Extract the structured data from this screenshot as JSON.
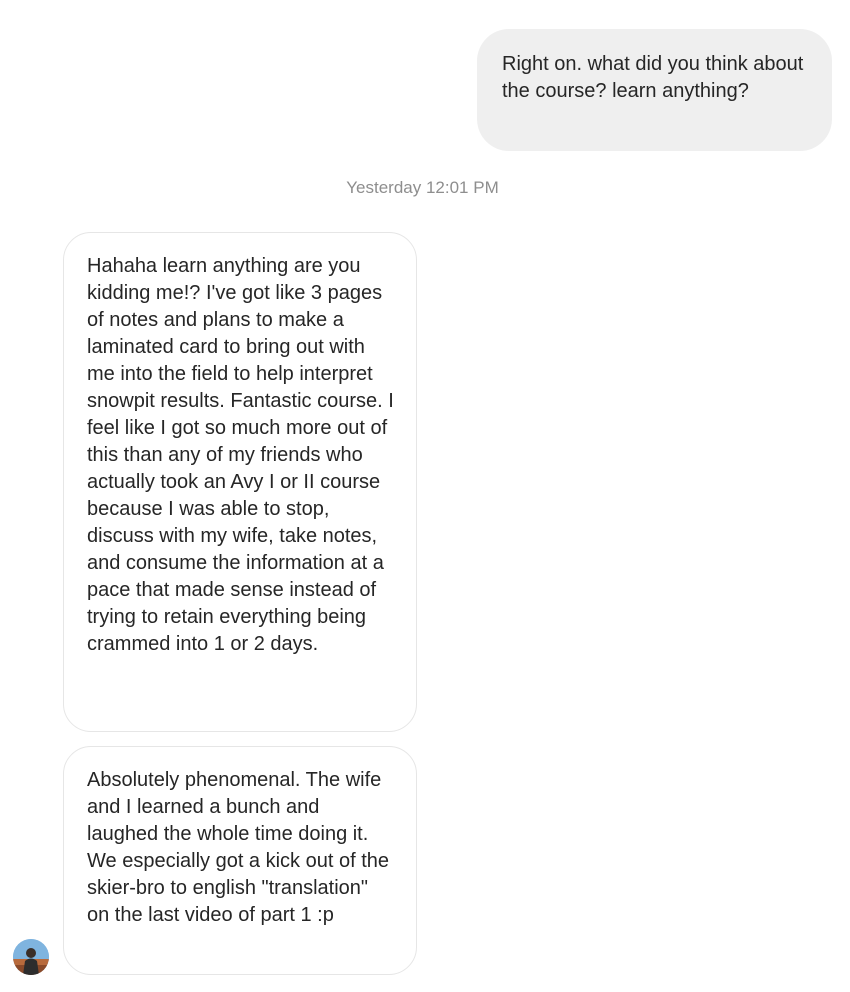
{
  "conversation": {
    "outgoing": {
      "text": "Right on. what did you think about the course? learn anything?"
    },
    "timestamp": "Yesterday 12:01 PM",
    "incoming": [
      {
        "text": "Hahaha learn anything are you kidding me!? I've got like 3 pages of notes and plans to make a laminated card to bring out with me into the field to help interpret snowpit results. Fantastic course. I feel like I got so much more out of this than any of my friends who actually took an Avy I or II course because I was able to stop, discuss with my wife, take notes, and consume the information at a pace that made sense instead of trying to retain everything being crammed into 1 or 2 days."
      },
      {
        "text": "Absolutely phenomenal. The wife and I learned a bunch and laughed the whole time doing it. We especially got a kick out of the skier-bro to english \"translation\" on the last video of part 1 :p"
      }
    ]
  },
  "colors": {
    "outgoing_bubble": "#efefef",
    "incoming_border": "#e6e6e6",
    "timestamp_text": "#8e8e8e",
    "message_text": "#262626"
  },
  "icons": {
    "avatar": "user-avatar"
  }
}
